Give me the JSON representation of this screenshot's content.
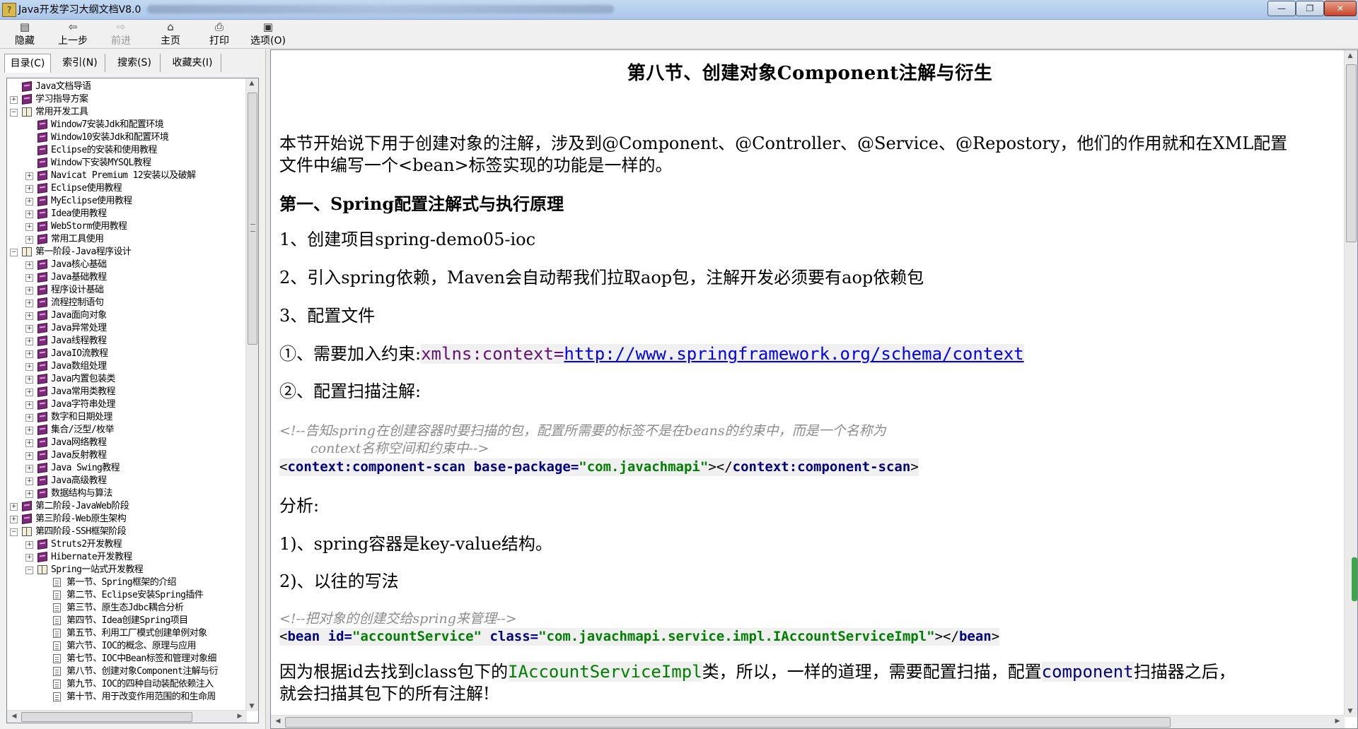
{
  "window": {
    "title": "Java开发学习大纲文档V8.0",
    "minimize": "—",
    "restore": "❐",
    "close": "✕"
  },
  "toolbar": {
    "hide_label": "隐藏",
    "back_label": "上一步",
    "forward_label": "前进",
    "home_label": "主页",
    "print_label": "打印",
    "options_label": "选项(O)"
  },
  "tabs": [
    {
      "label": "目录(C)"
    },
    {
      "label": "索引(N)"
    },
    {
      "label": "搜索(S)"
    },
    {
      "label": "收藏夹(I)"
    }
  ],
  "tree": [
    {
      "label": "Java文档导语",
      "indent": 0,
      "expander": "",
      "icon": "book"
    },
    {
      "label": "学习指导方案",
      "indent": 0,
      "expander": "+",
      "icon": "book"
    },
    {
      "label": "常用开发工具",
      "indent": 0,
      "expander": "-",
      "icon": "openbook"
    },
    {
      "label": "Window7安装Jdk和配置环境",
      "indent": 1,
      "expander": "",
      "icon": "book"
    },
    {
      "label": "Window10安装Jdk和配置环境",
      "indent": 1,
      "expander": "",
      "icon": "book"
    },
    {
      "label": "Eclipse的安装和使用教程",
      "indent": 1,
      "expander": "",
      "icon": "book"
    },
    {
      "label": "Window下安装MYSQL教程",
      "indent": 1,
      "expander": "",
      "icon": "book"
    },
    {
      "label": "Navicat Premium 12安装以及破解",
      "indent": 1,
      "expander": "+",
      "icon": "book"
    },
    {
      "label": "Eclipse使用教程",
      "indent": 1,
      "expander": "+",
      "icon": "book"
    },
    {
      "label": "MyEclipse使用教程",
      "indent": 1,
      "expander": "+",
      "icon": "book"
    },
    {
      "label": "Idea使用教程",
      "indent": 1,
      "expander": "+",
      "icon": "book"
    },
    {
      "label": "WebStorm使用教程",
      "indent": 1,
      "expander": "+",
      "icon": "book"
    },
    {
      "label": "常用工具使用",
      "indent": 1,
      "expander": "+",
      "icon": "book"
    },
    {
      "label": "第一阶段-Java程序设计",
      "indent": 0,
      "expander": "-",
      "icon": "openbook"
    },
    {
      "label": "Java核心基础",
      "indent": 1,
      "expander": "+",
      "icon": "book"
    },
    {
      "label": "Java基础教程",
      "indent": 1,
      "expander": "+",
      "icon": "book"
    },
    {
      "label": "程序设计基础",
      "indent": 1,
      "expander": "+",
      "icon": "book"
    },
    {
      "label": "流程控制语句",
      "indent": 1,
      "expander": "+",
      "icon": "book"
    },
    {
      "label": "Java面向对象",
      "indent": 1,
      "expander": "+",
      "icon": "book"
    },
    {
      "label": "Java异常处理",
      "indent": 1,
      "expander": "+",
      "icon": "book"
    },
    {
      "label": "Java线程教程",
      "indent": 1,
      "expander": "+",
      "icon": "book"
    },
    {
      "label": "JavaIO流教程",
      "indent": 1,
      "expander": "+",
      "icon": "book"
    },
    {
      "label": "Java数组处理",
      "indent": 1,
      "expander": "+",
      "icon": "book"
    },
    {
      "label": "Java内置包装类",
      "indent": 1,
      "expander": "+",
      "icon": "book"
    },
    {
      "label": "Java常用类教程",
      "indent": 1,
      "expander": "+",
      "icon": "book"
    },
    {
      "label": "Java字符串处理",
      "indent": 1,
      "expander": "+",
      "icon": "book"
    },
    {
      "label": "数字和日期处理",
      "indent": 1,
      "expander": "+",
      "icon": "book"
    },
    {
      "label": "集合/泛型/枚举",
      "indent": 1,
      "expander": "+",
      "icon": "book"
    },
    {
      "label": "Java网络教程",
      "indent": 1,
      "expander": "+",
      "icon": "book"
    },
    {
      "label": "Java反射教程",
      "indent": 1,
      "expander": "+",
      "icon": "book"
    },
    {
      "label": "Java Swing教程",
      "indent": 1,
      "expander": "+",
      "icon": "book"
    },
    {
      "label": "Java高级教程",
      "indent": 1,
      "expander": "+",
      "icon": "book"
    },
    {
      "label": "数据结构与算法",
      "indent": 1,
      "expander": "+",
      "icon": "book"
    },
    {
      "label": "第二阶段-JavaWeb阶段",
      "indent": 0,
      "expander": "+",
      "icon": "book"
    },
    {
      "label": "第三阶段-Web原生架构",
      "indent": 0,
      "expander": "+",
      "icon": "book"
    },
    {
      "label": "第四阶段-SSH框架阶段",
      "indent": 0,
      "expander": "-",
      "icon": "openbook"
    },
    {
      "label": "Struts2开发教程",
      "indent": 1,
      "expander": "+",
      "icon": "book"
    },
    {
      "label": "Hibernate开发教程",
      "indent": 1,
      "expander": "+",
      "icon": "book"
    },
    {
      "label": "Spring一站式开发教程",
      "indent": 1,
      "expander": "-",
      "icon": "openbook"
    },
    {
      "label": "第一节、Spring框架的介绍",
      "indent": 2,
      "expander": "",
      "icon": "page"
    },
    {
      "label": "第二节、Eclipse安装Spring插件",
      "indent": 2,
      "expander": "",
      "icon": "page"
    },
    {
      "label": "第三节、原生态Jdbc耦合分析",
      "indent": 2,
      "expander": "",
      "icon": "page"
    },
    {
      "label": "第四节、Idea创建Spring项目",
      "indent": 2,
      "expander": "",
      "icon": "page"
    },
    {
      "label": "第五节、利用工厂模式创建单例对象",
      "indent": 2,
      "expander": "",
      "icon": "page"
    },
    {
      "label": "第六节、IOC的概念、原理与应用",
      "indent": 2,
      "expander": "",
      "icon": "page"
    },
    {
      "label": "第七节、IOC中Bean标签和管理对象细",
      "indent": 2,
      "expander": "",
      "icon": "page"
    },
    {
      "label": "第八节、创建对象Component注解与衍",
      "indent": 2,
      "expander": "",
      "icon": "page"
    },
    {
      "label": "第九节、IOC的四种自动装配依赖注入",
      "indent": 2,
      "expander": "",
      "icon": "page"
    },
    {
      "label": "第十节、用于改变作用范围的和生命周",
      "indent": 2,
      "expander": "",
      "icon": "page"
    }
  ],
  "doc": {
    "title": "第八节、创建对象Component注解与衍生",
    "intro_line1": "本节开始说下用于创建对象的注解，涉及到@Component、@Controller、@Service、@Repostory，他们的作用就和在XML配置",
    "intro_line2": "文件中编写一个<bean>标签实现的功能是一样的。",
    "h2_1": "第一、Spring配置注解式与执行原理",
    "step1": "1、创建项目spring-demo05-ioc",
    "step2": "2、引入spring依赖，Maven会自动帮我们拉取aop包，注解开发必须要有aop依赖包",
    "step3": "3、配置文件",
    "sub1_prefix": "①、需要加入约束:",
    "sub1_ns_attr": "xmlns:context=",
    "sub1_url": "http://www.springframework.org/schema/context",
    "sub2": "②、配置扫描注解:",
    "comment1_line1": "<!--告知spring在创建容器时要扫描的包，配置所需要的标签不是在beans的约束中，而是一个名称为",
    "comment1_line2": "context名称空间和约束中-->",
    "code1_open": "<",
    "code1_tag": "context:component-scan",
    "code1_attr": " base-package=",
    "code1_value": "\"com.javachmapi\"",
    "code1_mid": "></",
    "code1_tag2": "context:component-scan",
    "code1_close": ">",
    "analysis": "分析:",
    "point1": "1)、spring容器是key-value结构。",
    "point2": "2)、以往的写法",
    "comment2": "<!--把对象的创建交给spring来管理-->",
    "code2_open": "<",
    "code2_tag": "bean",
    "code2_attr1": " id=",
    "code2_val1": "\"accountService\"",
    "code2_attr2": " class=",
    "code2_val2": "\"com.javachmapi.service.impl.IAccountServiceImpl\"",
    "code2_mid": "></",
    "code2_tag2": "bean",
    "code2_close": ">",
    "final_line1_a": "因为根据id去找到class包下的",
    "final_line1_b": "IAccountServiceImpl",
    "final_line1_c": "类，所以，一样的道理，需要配置扫描，配置",
    "final_line1_d": "component",
    "final_line1_e": "扫描器之后，",
    "final_line2": "就会扫描其包下的所有注解!"
  }
}
